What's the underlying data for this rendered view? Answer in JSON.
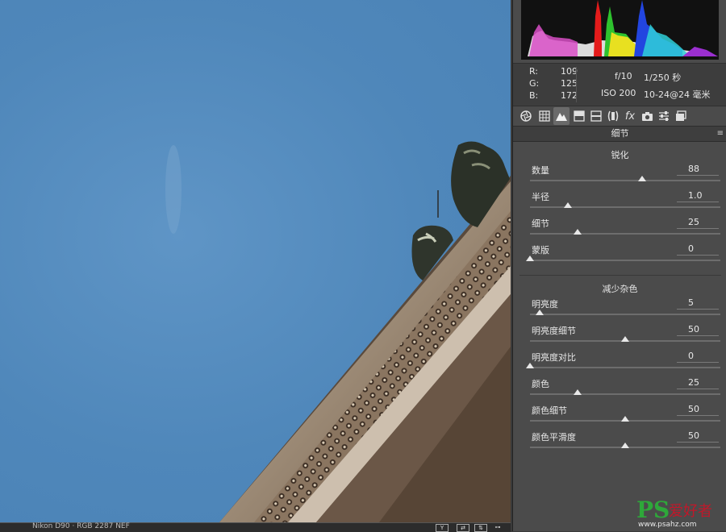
{
  "histogram": {
    "channels": [
      "red",
      "green",
      "blue",
      "yellow",
      "cyan",
      "magenta"
    ]
  },
  "readouts": {
    "r_label": "R:",
    "r_value": "109",
    "g_label": "G:",
    "g_value": "125",
    "b_label": "B:",
    "b_value": "172",
    "aperture": "f/10",
    "shutter": "1/250 秒",
    "iso": "ISO 200",
    "lens": "10-24@24 毫米"
  },
  "tabs": [
    {
      "icon": "aperture-icon"
    },
    {
      "icon": "grid-icon"
    },
    {
      "icon": "mountain-icon",
      "active": true
    },
    {
      "icon": "split-tone-icon"
    },
    {
      "icon": "hsl-icon"
    },
    {
      "icon": "lens-icon"
    },
    {
      "icon": "fx-icon",
      "glyph": "fx"
    },
    {
      "icon": "camera-icon"
    },
    {
      "icon": "sliders-icon"
    },
    {
      "icon": "presets-icon"
    }
  ],
  "panel": {
    "section_title": "细节",
    "menu_icon": "≡",
    "sharpen": {
      "title": "锐化",
      "sliders": [
        {
          "label": "数量",
          "value": "88",
          "fraction": 0.59
        },
        {
          "label": "半径",
          "value": "1.0",
          "fraction": 0.2
        },
        {
          "label": "细节",
          "value": "25",
          "fraction": 0.25
        },
        {
          "label": "蒙版",
          "value": "0",
          "fraction": 0.0
        }
      ]
    },
    "noise": {
      "title": "减少杂色",
      "sliders": [
        {
          "label": "明亮度",
          "value": "5",
          "fraction": 0.05
        },
        {
          "label": "明亮度细节",
          "value": "50",
          "fraction": 0.5
        },
        {
          "label": "明亮度对比",
          "value": "0",
          "fraction": 0.0
        },
        {
          "label": "颜色",
          "value": "25",
          "fraction": 0.25
        },
        {
          "label": "颜色细节",
          "value": "50",
          "fraction": 0.5
        },
        {
          "label": "颜色平滑度",
          "value": "50",
          "fraction": 0.5
        }
      ]
    }
  },
  "bottom_bar": {
    "file_info": "Nikon D90 · RGB 2287 NEF"
  },
  "watermark": {
    "ps": "PS",
    "cn": "爱好者",
    "url": "www.psahz.com"
  },
  "colors": {
    "sky": "#5089bd",
    "panel": "#4b4b4b",
    "thumb": "#e8e8e8"
  }
}
